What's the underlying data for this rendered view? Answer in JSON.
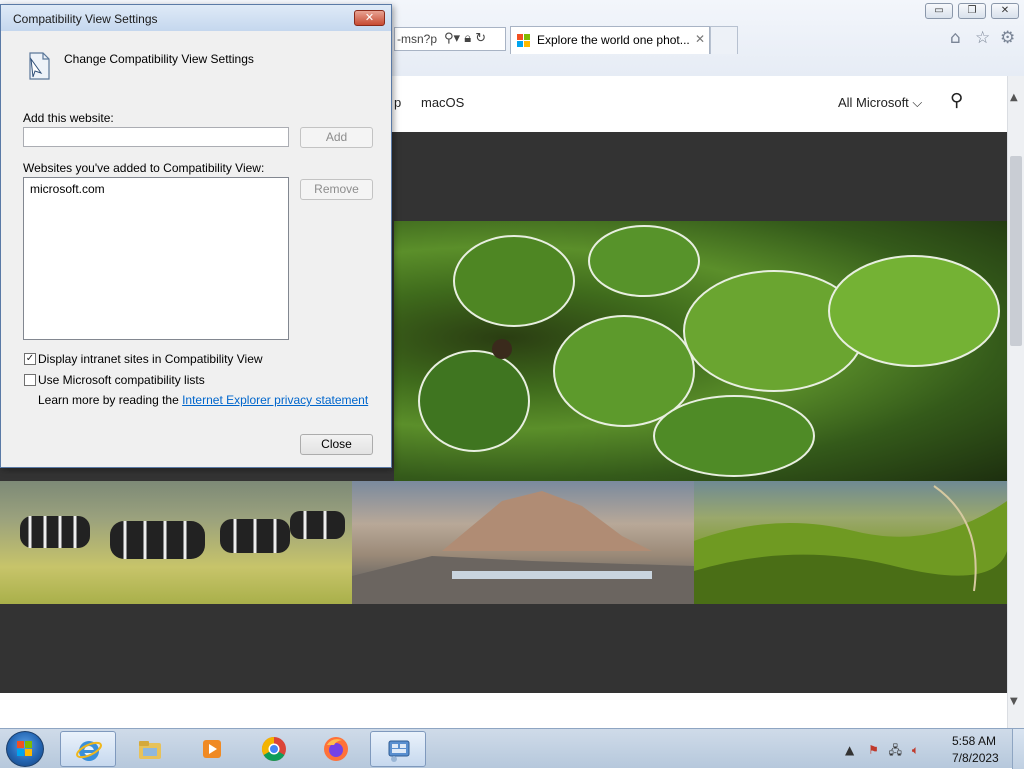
{
  "browser": {
    "address_text": "-msn?p",
    "tab_title": "Explore the world one phot...",
    "tab_close": "✕",
    "win_minimize": "▭",
    "win_restore": "❐",
    "win_close": "✕",
    "toolbar_icons": [
      "home-icon",
      "favorites-star-icon",
      "settings-gear-icon"
    ]
  },
  "page": {
    "nav_partial": "p",
    "nav_macos": "macOS",
    "nav_all_microsoft": "All Microsoft",
    "nav_all_microsoft_chevron": "⌵",
    "search_glyph": "⚲"
  },
  "dialog": {
    "title": "Compatibility View Settings",
    "close_glyph": "✕",
    "heading": "Change Compatibility View Settings",
    "add_label": "Add this website:",
    "add_input_value": "",
    "add_button": "Add",
    "list_label": "Websites you've added to Compatibility View:",
    "list_items": [
      "microsoft.com"
    ],
    "remove_button": "Remove",
    "checkbox_intranet": {
      "label": "Display intranet sites in Compatibility View",
      "checked": true
    },
    "checkbox_mslists": {
      "label": "Use Microsoft compatibility lists",
      "checked": false
    },
    "learn_more_prefix": "Learn more by reading the ",
    "learn_more_link": "Internet Explorer privacy statement",
    "close_button": "Close"
  },
  "taskbar": {
    "items": [
      "start-button",
      "internet-explorer",
      "windows-explorer",
      "media-player",
      "chrome",
      "firefox",
      "control-panel"
    ],
    "clock_time": "5:58 AM",
    "clock_date": "7/8/2023",
    "tray_overflow": "▲"
  },
  "colors": {
    "dialog_bg": "#f0f0f0",
    "link": "#0066cc",
    "page_dark_band": "#333333",
    "taskbar": "#c6d5e6"
  }
}
